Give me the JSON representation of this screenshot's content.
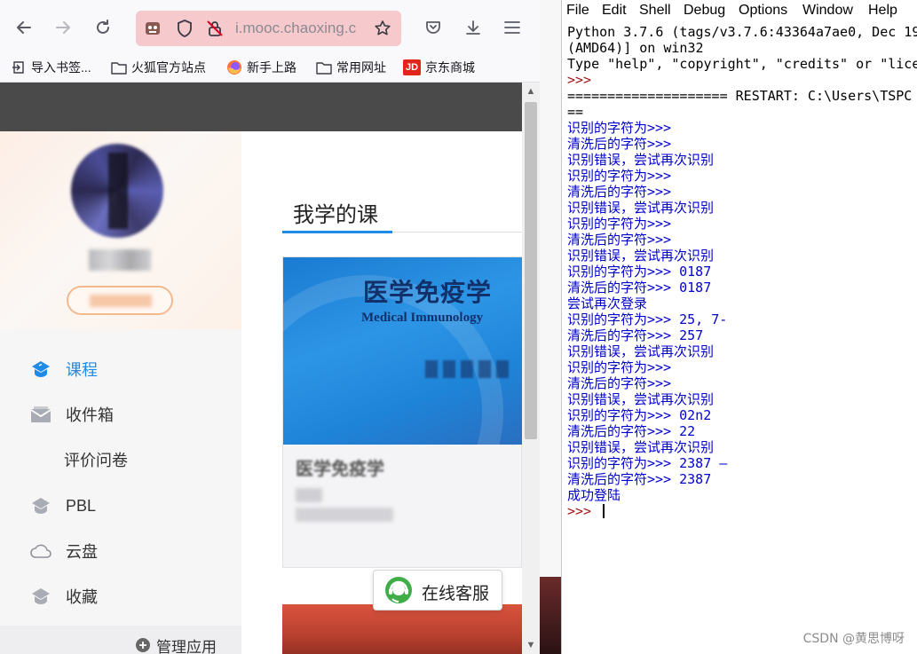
{
  "browser": {
    "url": "i.mooc.chaoxing.c",
    "bookmarks": [
      {
        "label": "导入书签...",
        "icon": "import-icon"
      },
      {
        "label": "火狐官方站点",
        "icon": "folder-icon"
      },
      {
        "label": "新手上路",
        "icon": "firefox-icon"
      },
      {
        "label": "常用网址",
        "icon": "folder-icon"
      },
      {
        "label": "京东商城",
        "icon": "jd-icon",
        "icon_text": "JD"
      }
    ]
  },
  "sidebar": {
    "user_name": "███",
    "account_button": "████",
    "nav": [
      {
        "label": "课程",
        "icon": "course-icon",
        "active": true
      },
      {
        "label": "收件箱",
        "icon": "inbox-icon",
        "active": false
      },
      {
        "label": "评价问卷",
        "icon": "",
        "active": false
      },
      {
        "label": "PBL",
        "icon": "pbl-icon",
        "active": false
      },
      {
        "label": "云盘",
        "icon": "cloud-icon",
        "active": false
      },
      {
        "label": "收藏",
        "icon": "favorites-icon",
        "active": false
      }
    ],
    "manage_apps": "管理应用"
  },
  "main": {
    "title": "我学的课",
    "course": {
      "cover_title_zh": "医学免疫学",
      "cover_title_en": "Medical Immunology",
      "name": "医学免疫学",
      "teacher": "██",
      "school": "██████"
    },
    "online_service": "在线客服"
  },
  "idle": {
    "menu": [
      "File",
      "Edit",
      "Shell",
      "Debug",
      "Options",
      "Window",
      "Help"
    ],
    "lines": [
      {
        "text": "Python 3.7.6 (tags/v3.7.6:43364a7ae0, Dec 19",
        "color": "black"
      },
      {
        "text": "(AMD64)] on win32",
        "color": "black"
      },
      {
        "text": "Type \"help\", \"copyright\", \"credits\" or \"lice",
        "color": "black"
      },
      {
        "text": ">>> ",
        "color": "red"
      },
      {
        "text": "==================== RESTART: C:\\Users\\TSPC",
        "color": "black"
      },
      {
        "text": "==",
        "color": "black"
      },
      {
        "text": "识别的字符为>>>",
        "color": "blue"
      },
      {
        "text": "清洗后的字符>>>",
        "color": "blue"
      },
      {
        "text": "识别错误，尝试再次识别",
        "color": "blue"
      },
      {
        "text": "识别的字符为>>>",
        "color": "blue"
      },
      {
        "text": "清洗后的字符>>>",
        "color": "blue"
      },
      {
        "text": "识别错误，尝试再次识别",
        "color": "blue"
      },
      {
        "text": "识别的字符为>>>",
        "color": "blue"
      },
      {
        "text": "清洗后的字符>>>",
        "color": "blue"
      },
      {
        "text": "识别错误，尝试再次识别",
        "color": "blue"
      },
      {
        "text": "识别的字符为>>> 0187",
        "color": "blue"
      },
      {
        "text": "清洗后的字符>>> 0187",
        "color": "blue"
      },
      {
        "text": "尝试再次登录",
        "color": "blue"
      },
      {
        "text": "识别的字符为>>> 25, 7-",
        "color": "blue"
      },
      {
        "text": "清洗后的字符>>> 257",
        "color": "blue"
      },
      {
        "text": "识别错误，尝试再次识别",
        "color": "blue"
      },
      {
        "text": "识别的字符为>>>",
        "color": "blue"
      },
      {
        "text": "清洗后的字符>>>",
        "color": "blue"
      },
      {
        "text": "识别错误，尝试再次识别",
        "color": "blue"
      },
      {
        "text": "识别的字符为>>> 02n2",
        "color": "blue"
      },
      {
        "text": "清洗后的字符>>> 22",
        "color": "blue"
      },
      {
        "text": "识别错误，尝试再次识别",
        "color": "blue"
      },
      {
        "text": "识别的字符为>>> 2387 —",
        "color": "blue"
      },
      {
        "text": "清洗后的字符>>> 2387",
        "color": "blue"
      },
      {
        "text": "成功登陆",
        "color": "blue"
      }
    ],
    "prompt": ">>> "
  },
  "watermark": "CSDN @黄思博呀",
  "colors": {
    "accent_blue": "#1f8be8",
    "urlbar_pink": "#f6c9cc",
    "idle_output_blue": "#0000cc",
    "idle_prompt_red": "#a31515"
  }
}
